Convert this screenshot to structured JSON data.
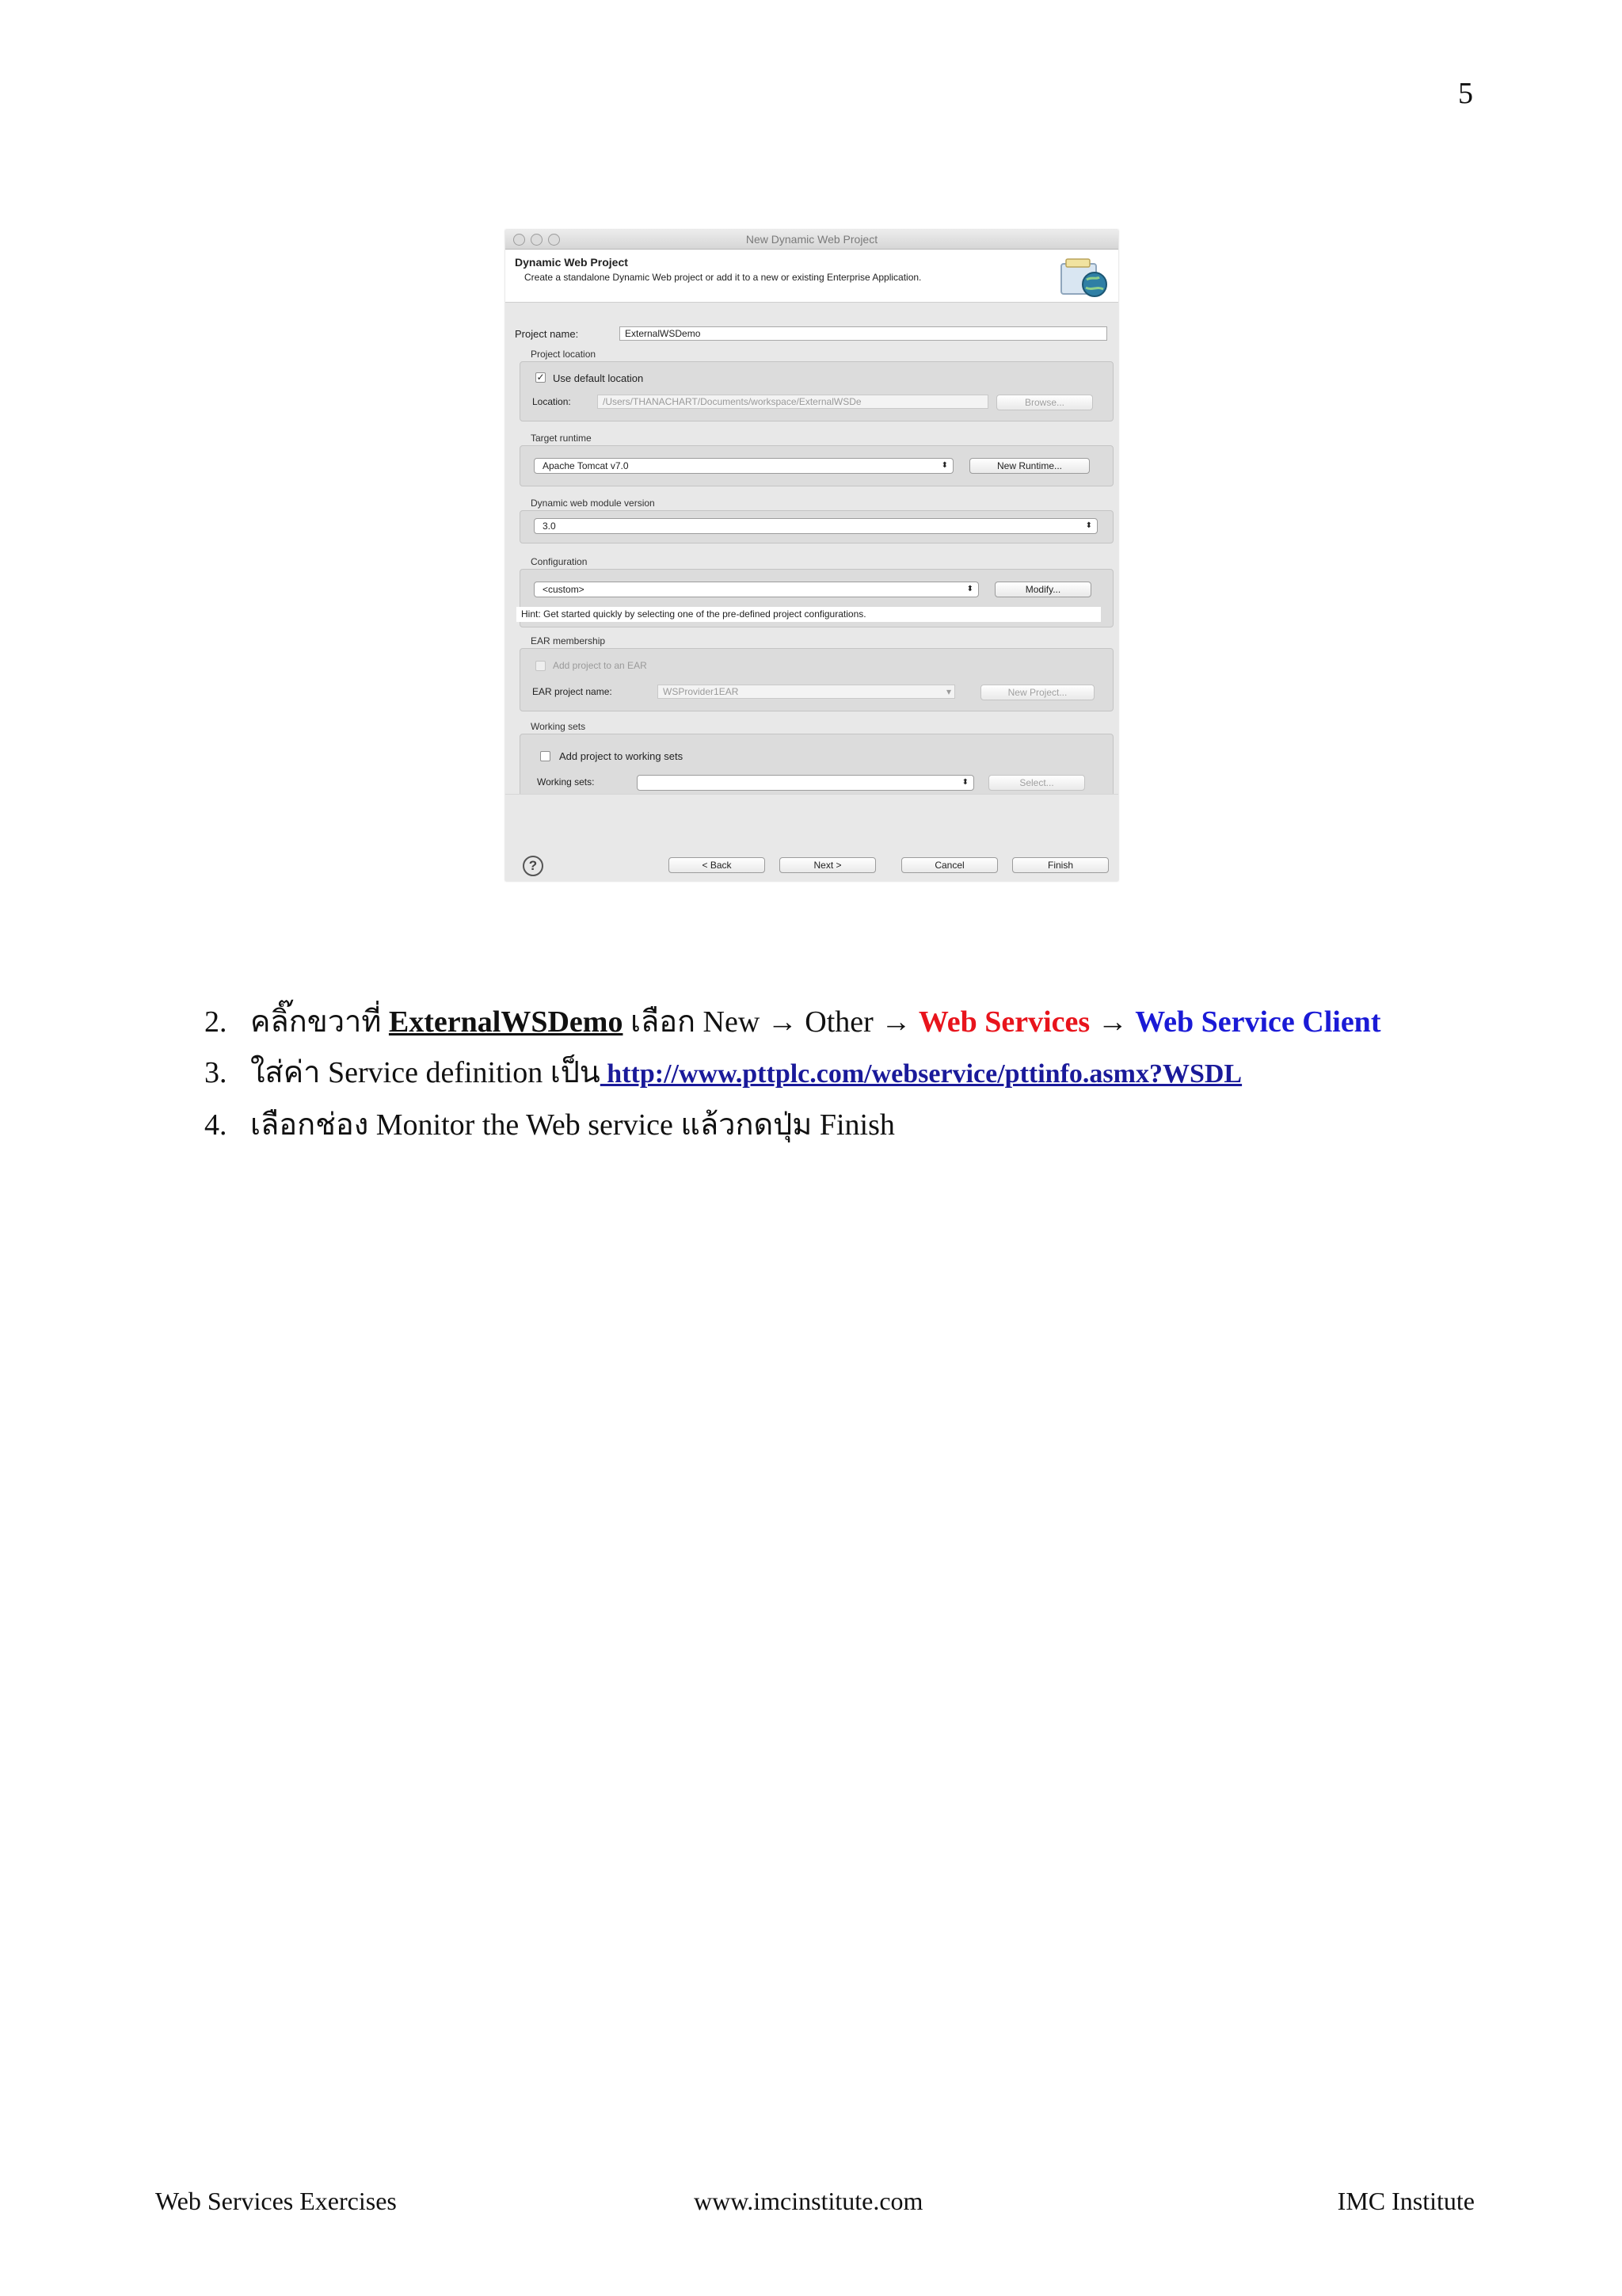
{
  "page": {
    "number": "5"
  },
  "dialog": {
    "window_title": "New Dynamic Web Project",
    "header_title": "Dynamic Web Project",
    "header_desc": "Create a standalone Dynamic Web project or add it to a new or existing Enterprise Application.",
    "project_name_label": "Project name:",
    "project_name_value": "ExternalWSDemo",
    "project_location_label": "Project location",
    "use_default_label": "Use default location",
    "use_default_checked": "✓",
    "location_label": "Location:",
    "location_value": "/Users/THANACHART/Documents/workspace/ExternalWSDe",
    "browse_label": "Browse...",
    "target_runtime_label": "Target runtime",
    "target_runtime_value": "Apache Tomcat v7.0",
    "new_runtime_label": "New Runtime...",
    "module_version_label": "Dynamic web module version",
    "module_version_value": "3.0",
    "configuration_label": "Configuration",
    "configuration_value": "<custom>",
    "modify_label": "Modify...",
    "hint": "Hint: Get started quickly by selecting one of the pre-defined project configurations.",
    "ear_membership_label": "EAR membership",
    "add_to_ear_label": "Add project to an EAR",
    "ear_project_name_label": "EAR project name:",
    "ear_project_name_value": "WSProvider1EAR",
    "new_project_label": "New Project...",
    "working_sets_label": "Working sets",
    "add_to_working_sets_label": "Add project to working sets",
    "working_sets_field_label": "Working sets:",
    "select_label": "Select...",
    "select_arrows": "⬍",
    "combo_arrow": "▾",
    "help_glyph": "?",
    "back_label": "< Back",
    "next_label": "Next >",
    "cancel_label": "Cancel",
    "finish_label": "Finish"
  },
  "steps": [
    {
      "num": "2.",
      "t1": "คลิ๊กขวาที่ ",
      "project": "ExternalWSDemo",
      "t2": " เลือก New → Other → ",
      "ws": "Web Services",
      "t3": " → ",
      "client": "Web Service Client"
    },
    {
      "num": "3.",
      "t1": "ใส่ค่า Service definition เป็น",
      "url": " http://www.pttplc.com/webservice/pttinfo.asmx?WSDL"
    },
    {
      "num": "4.",
      "t1": "เลือกช่อง Monitor the Web service แล้วกดปุ่ม Finish"
    }
  ],
  "footer": {
    "left": "Web Services Exercises",
    "center": "www.imcinstitute.com",
    "right": "IMC Institute"
  },
  "colors": {
    "red_text": "#e8141c",
    "blue_text": "#1a1ad6",
    "link_text": "#1a1a9a"
  }
}
